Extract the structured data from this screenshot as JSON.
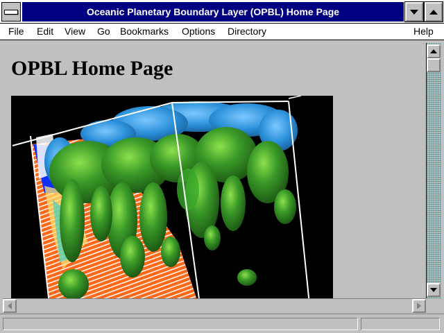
{
  "window": {
    "title": "Oceanic Planetary Boundary Layer (OPBL) Home Page"
  },
  "menu": {
    "items": [
      {
        "label": "File"
      },
      {
        "label": "Edit"
      },
      {
        "label": "View"
      },
      {
        "label": "Go"
      },
      {
        "label": "Bookmarks"
      },
      {
        "label": "Options"
      },
      {
        "label": "Directory"
      }
    ],
    "help": "Help"
  },
  "page": {
    "heading": "OPBL Home Page"
  },
  "colors": {
    "titlebar": "#000080",
    "chrome": "#c0c0c0",
    "viz_bg": "#000000",
    "ocean_blue": "#2a8fd8",
    "plume_green": "#2e8b22",
    "plume_highlight": "#6ccf3c",
    "orange": "#ff6a1a"
  },
  "icons": {
    "system_menu": "system-menu-icon",
    "minimize": "minimize-icon",
    "maximize": "maximize-icon",
    "scroll_up": "arrow-up-icon",
    "scroll_down": "arrow-down-icon",
    "scroll_left": "arrow-left-icon",
    "scroll_right": "arrow-right-icon"
  }
}
